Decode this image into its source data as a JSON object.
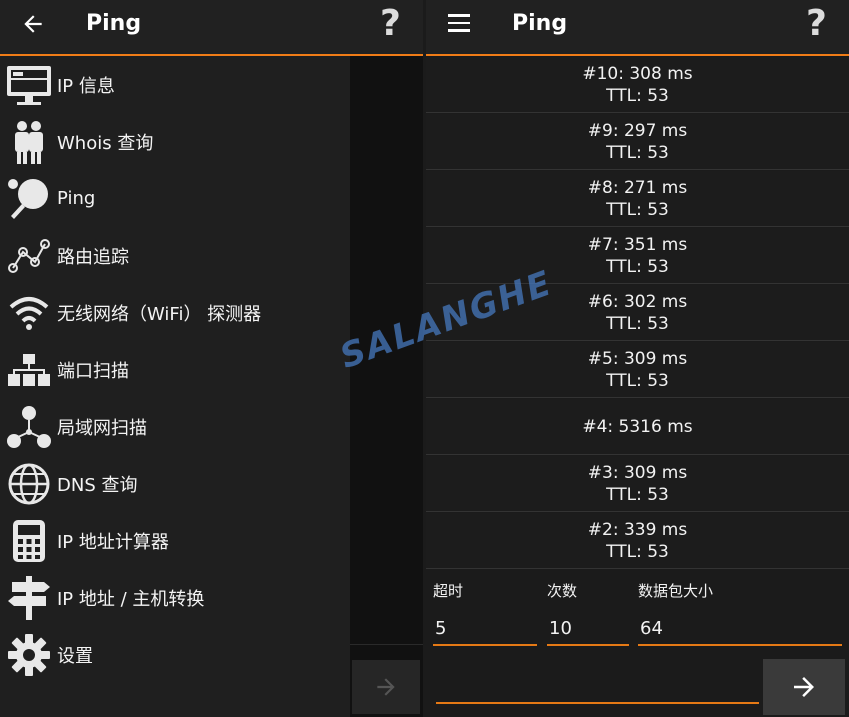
{
  "left": {
    "title": "Ping",
    "help": "?",
    "drawer_items": [
      {
        "label": "IP 信息",
        "icon": "monitor-icon"
      },
      {
        "label": "Whois 查询",
        "icon": "people-icon"
      },
      {
        "label": "Ping",
        "icon": "ping-pong-icon"
      },
      {
        "label": "路由追踪",
        "icon": "route-icon"
      },
      {
        "label": "无线网络（WiFi） 探测器",
        "icon": "wifi-icon"
      },
      {
        "label": "端口扫描",
        "icon": "network-icon"
      },
      {
        "label": "局域网扫描",
        "icon": "lan-icon"
      },
      {
        "label": "DNS 查询",
        "icon": "globe-icon"
      },
      {
        "label": "IP 地址计算器",
        "icon": "calculator-icon"
      },
      {
        "label": "IP 地址 / 主机转换",
        "icon": "signpost-icon"
      },
      {
        "label": "设置",
        "icon": "gear-icon"
      }
    ]
  },
  "right": {
    "title": "Ping",
    "help": "?",
    "results": [
      {
        "time": "#10: 308 ms",
        "ttl": "TTL: 53"
      },
      {
        "time": "#9: 297 ms",
        "ttl": "TTL: 53"
      },
      {
        "time": "#8: 271 ms",
        "ttl": "TTL: 53"
      },
      {
        "time": "#7: 351 ms",
        "ttl": "TTL: 53"
      },
      {
        "time": "#6: 302 ms",
        "ttl": "TTL: 53"
      },
      {
        "time": "#5: 309 ms",
        "ttl": "TTL: 53"
      },
      {
        "time": "#4: 5316 ms",
        "ttl": ""
      },
      {
        "time": "#3: 309 ms",
        "ttl": "TTL: 53"
      },
      {
        "time": "#2: 339 ms",
        "ttl": "TTL: 53"
      }
    ],
    "fields": {
      "timeout": {
        "label": "超时",
        "value": "5"
      },
      "count": {
        "label": "次数",
        "value": "10"
      },
      "packet_size": {
        "label": "数据包大小",
        "value": "64"
      }
    },
    "command": ""
  },
  "watermark": "SALANGHE",
  "colors": {
    "accent": "#f07c17",
    "background": "#1b1b1b"
  }
}
